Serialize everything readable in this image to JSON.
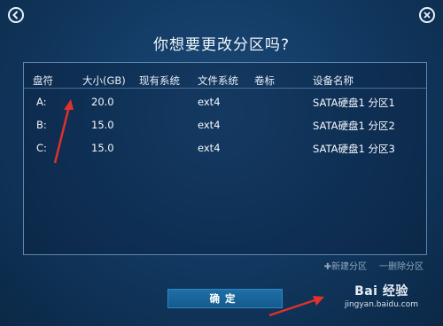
{
  "title": "你想要更改分区吗?",
  "table": {
    "headers": [
      "盘符",
      "大小(GB)",
      "现有系统",
      "文件系统",
      "卷标",
      "设备名称"
    ],
    "rows": [
      {
        "drive": "A:",
        "size": "20.0",
        "system": "",
        "fs": "ext4",
        "label": "",
        "device": "SATA硬盘1 分区1"
      },
      {
        "drive": "B:",
        "size": "15.0",
        "system": "",
        "fs": "ext4",
        "label": "",
        "device": "SATA硬盘1 分区2"
      },
      {
        "drive": "C:",
        "size": "15.0",
        "system": "",
        "fs": "ext4",
        "label": "",
        "device": "SATA硬盘1 分区3"
      }
    ]
  },
  "actions": {
    "new_partition": "✚新建分区",
    "delete_partition": "一删除分区"
  },
  "confirm_label": "确定",
  "watermark": {
    "brand": "Bai 经验",
    "url": "jingyan.baidu.com"
  },
  "icons": {
    "back": "back-arrow-icon",
    "close": "close-icon"
  },
  "colors": {
    "accent": "#1e6fa8",
    "annotation": "#e0312b"
  }
}
